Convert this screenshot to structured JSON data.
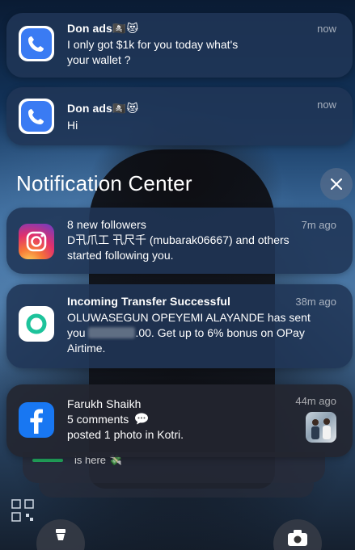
{
  "notifications_top": [
    {
      "app": "phone",
      "title": "Don ads🏴‍☠️😻",
      "time": "now",
      "body_line1": "I only got $1k for you today what's",
      "body_line2": "your wallet ?"
    },
    {
      "app": "phone",
      "title": "Don ads🏴‍☠️😻",
      "time": "now",
      "body_line1": "Hi"
    }
  ],
  "notification_center": {
    "header": "Notification Center",
    "close_label": "✕"
  },
  "instagram": {
    "title": "8 new followers",
    "time": "7m ago",
    "body_line1": "D卂爪工 卂尺千 (mubarak06667) and others",
    "body_line2": "started following you."
  },
  "opay": {
    "title": "Incoming Transfer Successful",
    "time": "38m ago",
    "body_line1": "OLUWASEGUN OPEYEMI ALAYANDE has sent",
    "body_line2_prefix": "you",
    "body_line2_suffix": ".00. Get up to 6% bonus on OPay",
    "body_line3": "Airtime."
  },
  "facebook": {
    "title": "Farukh Shaikh",
    "time": "44m ago",
    "body_line1": "5 comments",
    "body_line2": "posted 1 photo in Kotri."
  },
  "stack_peek": {
    "text": "is here 💸"
  },
  "colors": {
    "phone_icon_bg": "#ffffff",
    "phone_icon_fg": "#3a7bf3",
    "facebook_blue": "#1877f2",
    "opay_green": "#1dc39b"
  }
}
